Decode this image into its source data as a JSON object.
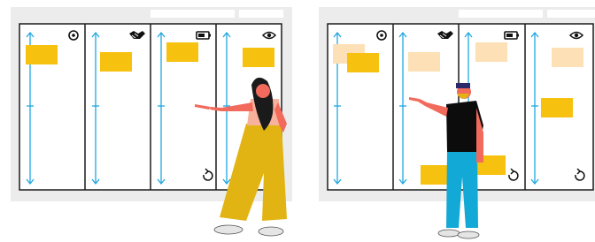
{
  "colors": {
    "backdrop": "#ececec",
    "board": "#ffffff",
    "board_border": "#1c1c1c",
    "arrow": "#1ea7e1",
    "note": "#f6c10f",
    "note_faded": "#fde0b6",
    "skin": "#f26a5b",
    "hair": "#1a1a1a",
    "pants_left": "#e2b413",
    "top_left": "#f8b19b",
    "shirt_right": "#0c0c0c",
    "pants_right": "#13a9d6"
  },
  "left_board": {
    "columns": [
      {
        "icon": "target-icon"
      },
      {
        "icon": "handshake-icon"
      },
      {
        "icon": "battery-icon"
      },
      {
        "icon": "eye-icon"
      }
    ],
    "notes": [
      "sticky",
      "sticky",
      "sticky",
      "sticky"
    ]
  },
  "right_board": {
    "columns": [
      {
        "icon": "target-icon"
      },
      {
        "icon": "handshake-icon"
      },
      {
        "icon": "battery-icon"
      },
      {
        "icon": "eye-icon"
      }
    ],
    "notes": [
      "sticky",
      "sticky",
      "sticky",
      "sticky",
      "sticky",
      "sticky",
      "sticky"
    ]
  }
}
